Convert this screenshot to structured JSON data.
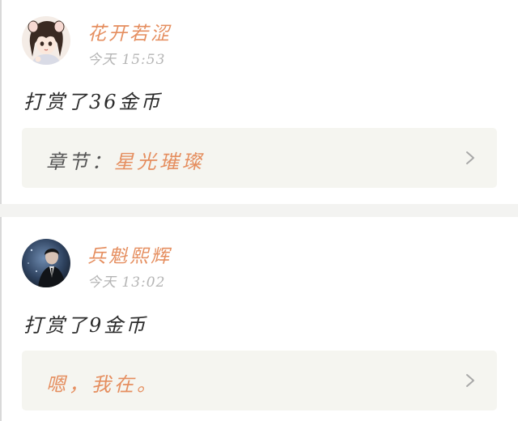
{
  "posts": [
    {
      "username": "花开若涩",
      "time": "今天 15:53",
      "reward": "打赏了36金币",
      "quote": {
        "label": "章节：",
        "highlight": "星光璀璨"
      }
    },
    {
      "username": "兵魁熙辉",
      "time": "今天 13:02",
      "reward": "打赏了9金币",
      "quote": {
        "label": "",
        "highlight": "嗯，我在。"
      }
    }
  ],
  "colors": {
    "accent": "#e58e5f",
    "time": "#b5b5b5",
    "text": "#2b2b2b",
    "box_bg": "#f5f5f0",
    "divider": "#f3f3f1"
  },
  "icons": {
    "chevron": "chevron-right-icon"
  }
}
